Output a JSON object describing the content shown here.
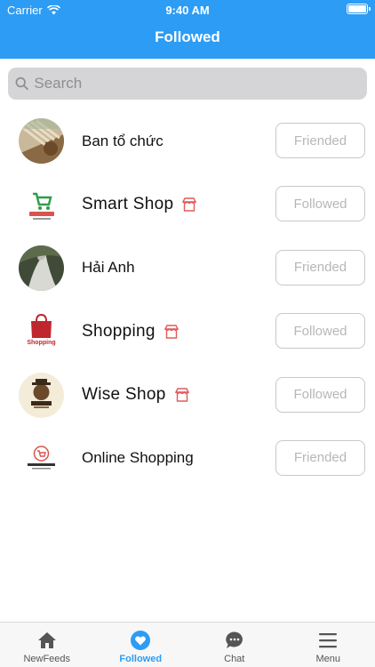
{
  "status_bar": {
    "carrier": "Carrier",
    "time": "9:40 AM"
  },
  "header": {
    "title": "Followed"
  },
  "search": {
    "placeholder": "Search"
  },
  "items": [
    {
      "name": "Ban tổ chức",
      "action": "Friended",
      "is_shop": false
    },
    {
      "name": "Smart Shop",
      "action": "Followed",
      "is_shop": true
    },
    {
      "name": "Hải Anh",
      "action": "Friended",
      "is_shop": false
    },
    {
      "name": "Shopping",
      "action": "Followed",
      "is_shop": true
    },
    {
      "name": "Wise Shop",
      "action": "Followed",
      "is_shop": true
    },
    {
      "name": "Online Shopping",
      "action": "Friended",
      "is_shop": false
    }
  ],
  "tabs": [
    {
      "label": "NewFeeds",
      "icon": "home-icon",
      "active": false
    },
    {
      "label": "Followed",
      "icon": "heart-icon",
      "active": true
    },
    {
      "label": "Chat",
      "icon": "chat-icon",
      "active": false
    },
    {
      "label": "Menu",
      "icon": "menu-icon",
      "active": false
    }
  ],
  "colors": {
    "accent": "#2d9cf4",
    "shop_icon": "#e05a5a",
    "button_border": "#c8c8c8",
    "button_text": "#b7b7b7"
  }
}
